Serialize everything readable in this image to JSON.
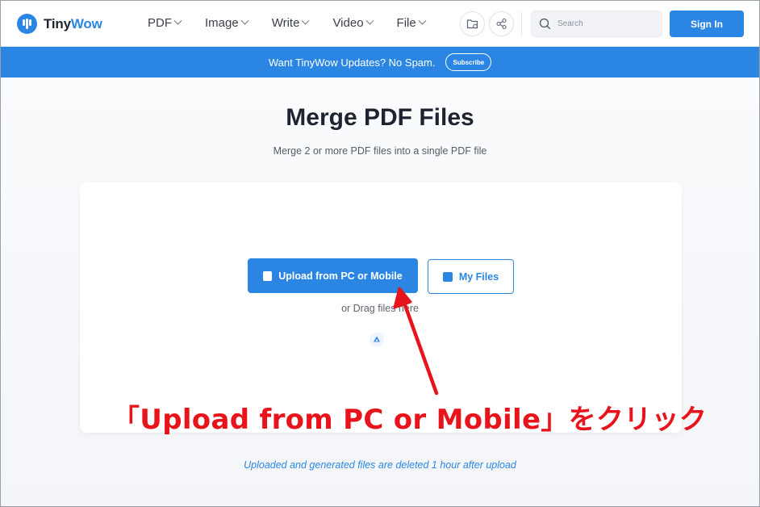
{
  "header": {
    "logo": {
      "part1": "Tiny",
      "part2": "Wow"
    },
    "nav": [
      {
        "label": "PDF"
      },
      {
        "label": "Image"
      },
      {
        "label": "Write"
      },
      {
        "label": "Video"
      },
      {
        "label": "File"
      }
    ],
    "search": {
      "placeholder": "Search",
      "value": ""
    },
    "signin_label": "Sign In"
  },
  "banner": {
    "text": "Want TinyWow Updates? No Spam.",
    "subscribe_label": "Subscribe"
  },
  "main": {
    "title": "Merge PDF Files",
    "subtitle": "Merge 2 or more PDF files into a single PDF file",
    "upload_label": "Upload from PC or Mobile",
    "myfiles_label": "My Files",
    "drag_text": "or Drag files here",
    "footer_note": "Uploaded and generated files are deleted 1 hour after upload"
  },
  "annotation": {
    "text": "「Upload from PC or Mobile」をクリック"
  },
  "icons": {
    "folder_share": "folder-share-icon",
    "share": "share-icon",
    "search": "search-icon",
    "google_drive": "google-drive-icon"
  },
  "colors": {
    "accent": "#2b86e3",
    "annotation": "#e8141c"
  }
}
